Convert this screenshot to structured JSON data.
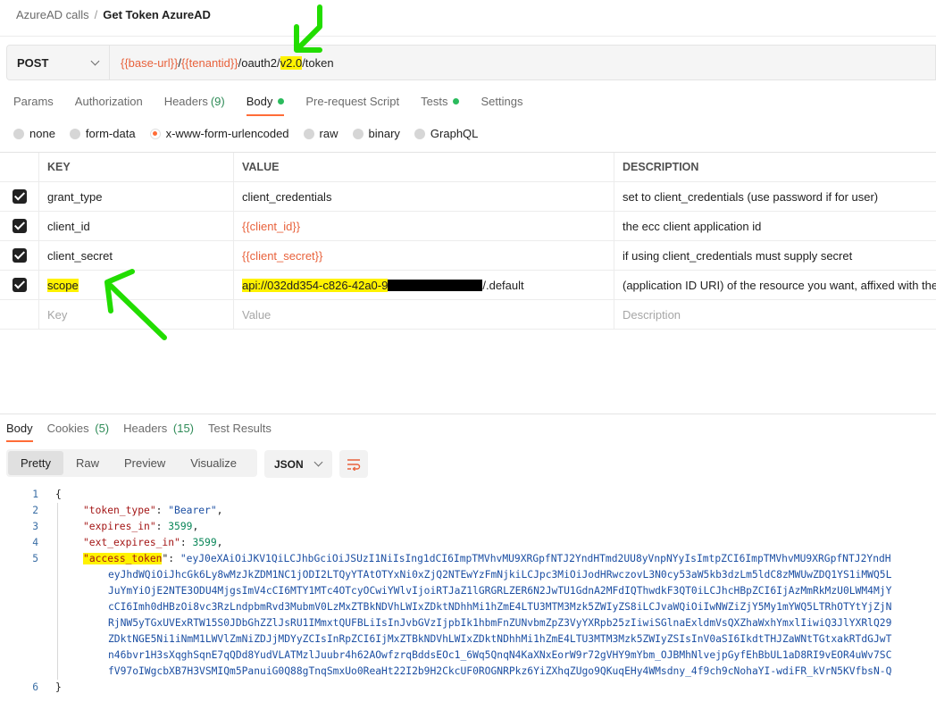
{
  "breadcrumb": {
    "parent": "AzureAD calls",
    "separator": "/",
    "current": "Get Token AzureAD"
  },
  "request": {
    "method": "POST",
    "url_parts": {
      "base": "{{base-url}}",
      "slash1": "/",
      "tenant": "{{tenantid}}",
      "mid": "/oauth2/",
      "version": "v2.0",
      "tail": "/token"
    }
  },
  "req_tabs": {
    "params": "Params",
    "authorization": "Authorization",
    "headers": "Headers",
    "headers_count": "(9)",
    "body": "Body",
    "prerequest": "Pre-request Script",
    "tests": "Tests",
    "settings": "Settings"
  },
  "body_types": {
    "none": "none",
    "form_data": "form-data",
    "urlencoded": "x-www-form-urlencoded",
    "raw": "raw",
    "binary": "binary",
    "graphql": "GraphQL"
  },
  "params_table": {
    "headers": {
      "key": "KEY",
      "value": "VALUE",
      "description": "DESCRIPTION"
    },
    "rows": [
      {
        "key": "grant_type",
        "value": "client_credentials",
        "description": "set to client_credentials (use password if for user)"
      },
      {
        "key": "client_id",
        "value": "{{client_id}}",
        "description": "the ecc client application id"
      },
      {
        "key": "client_secret",
        "value": "{{client_secret}}",
        "description": "if using client_credentials must supply secret"
      },
      {
        "key": "scope",
        "value_start": "api://032dd354-c826-42a0-9",
        "value_end": "/.default",
        "description": "(application ID URI) of the resource you want, affixed with the"
      }
    ],
    "placeholders": {
      "key": "Key",
      "value": "Value",
      "description": "Description"
    }
  },
  "response": {
    "tabs": {
      "body": "Body",
      "cookies": "Cookies",
      "cookies_count": "(5)",
      "headers": "Headers",
      "headers_count": "(15)",
      "test_results": "Test Results"
    },
    "view_modes": {
      "pretty": "Pretty",
      "raw": "Raw",
      "preview": "Preview",
      "visualize": "Visualize"
    },
    "format": "JSON",
    "line_numbers": [
      "1",
      "2",
      "3",
      "4",
      "5",
      "6"
    ],
    "json": {
      "open_brace": "{",
      "close_brace": "}",
      "token_type_key": "\"token_type\"",
      "token_type_value": "\"Bearer\"",
      "expires_in_key": "\"expires_in\"",
      "expires_in_value": "3599",
      "ext_expires_in_key": "\"ext_expires_in\"",
      "ext_expires_in_value": "3599",
      "access_token_quote": "\"",
      "access_token_name": "access_token",
      "colon": "\": ",
      "colon_plain": ": ",
      "comma": ",",
      "access_token_lines": [
        "\"eyJ0eXAiOiJKV1QiLCJhbGciOiJSUzI1NiIsIng1dCI6ImpTMVhvMU9XRGpfNTJ2YndHTmd2UU8yVnpNYyIsImtpZCI6ImpTMVhvMU9XRGpfNTJ2YndH",
        "eyJhdWQiOiJhcGk6Ly8wMzJkZDM1NC1jODI2LTQyYTAtOTYxNi0xZjQ2NTEwYzFmNjkiLCJpc3MiOiJodHRwczovL3N0cy53aW5kb3dzLm5ldC8zMWUwZDQ1YS1iMWQ5L",
        "JuYmYiOjE2NTE3ODU4MjgsImV4cCI6MTY1MTc4OTcyOCwiYWlvIjoiRTJaZ1lGRGRLZER6N2JwTU1GdnA2MFdIQThwdkF3QT0iLCJhcHBpZCI6IjAzMmRkMzU0LWM4MjY",
        "cCI6Imh0dHBzOi8vc3RzLndpbmRvd3MubmV0LzMxZTBkNDVhLWIxZDktNDhhMi1hZmE4LTU3MTM3Mzk5ZWIyZS8iLCJvaWQiOiIwNWZiZjY5My1mYWQ5LTRhOTYtYjZjN",
        "RjNW5yTGxUVExRTW15S0JDbGhZZlJsRU1IMmxtQUFBLiIsInJvbGVzIjpbIk1hbmFnZUNvbmZpZ3VyYXRpb25zIiwiSGlnaExldmVsQXZhaWxhYmxlIiwiQ3JlYXRlQ29",
        "ZDktNGE5Ni1iNmM1LWVlZmNiZDJjMDYyZCIsInRpZCI6IjMxZTBkNDVhLWIxZDktNDhhMi1hZmE4LTU3MTM3Mzk5ZWIyZSIsInV0aSI6IkdtTHJZaWNtTGtxakRTdGJwT",
        "n46bvr1H3sXqghSqnE7qQDd8YudVLATMzlJuubr4h62AOwfzrqBddsEOc1_6Wq5QnqN4KaXNxEorW9r72gVHY9mYbm_OJBMhNlvejpGyfEhBbUL1aD8RI9vEOR4uWv7SC",
        "fV97oIWgcbXB7H3VSMIQm5PanuiG0Q88gTnqSmxUo0ReaHt22I2b9H2CkcUF0ROGNRPkz6YiZXhqZUgo9QKuqEHy4WMsdny_4f9ch9cNohaYI-wdiFR_kVrN5KVfbsN-Q"
      ]
    }
  },
  "colors": {
    "accent": "#ff6c37",
    "variable": "#e8623c",
    "highlight": "#fff200",
    "annotation_arrow": "#22dd00",
    "status_dot": "#2bbb5d"
  }
}
